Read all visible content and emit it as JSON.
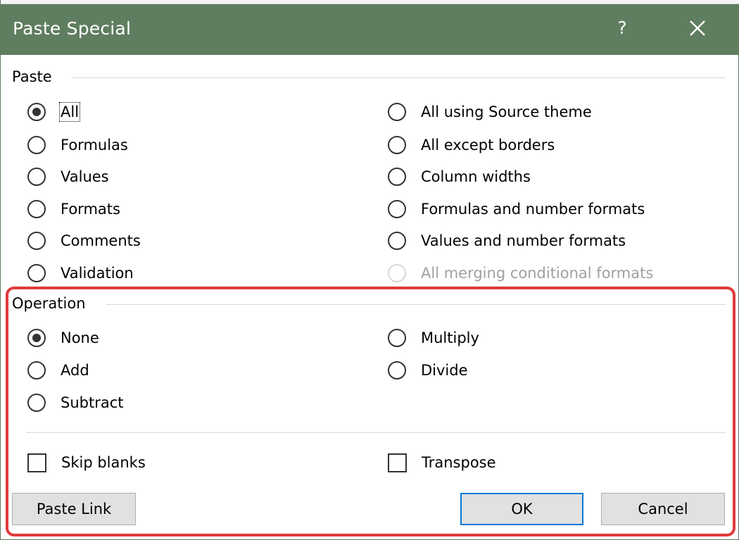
{
  "window": {
    "title": "Paste Special",
    "help_label": "?"
  },
  "paste_group": {
    "label": "Paste",
    "left_options": [
      {
        "label": "All",
        "checked": true
      },
      {
        "label": "Formulas",
        "checked": false
      },
      {
        "label": "Values",
        "checked": false
      },
      {
        "label": "Formats",
        "checked": false
      },
      {
        "label": "Comments",
        "checked": false
      },
      {
        "label": "Validation",
        "checked": false
      }
    ],
    "right_options": [
      {
        "label": "All using Source theme",
        "checked": false
      },
      {
        "label": "All except borders",
        "checked": false
      },
      {
        "label": "Column widths",
        "checked": false
      },
      {
        "label": "Formulas and number formats",
        "checked": false
      },
      {
        "label": "Values and number formats",
        "checked": false
      },
      {
        "label": "All merging conditional formats",
        "checked": false,
        "disabled": true
      }
    ]
  },
  "operation_group": {
    "label": "Operation",
    "left_options": [
      {
        "label": "None",
        "checked": true
      },
      {
        "label": "Add",
        "checked": false
      },
      {
        "label": "Subtract",
        "checked": false
      }
    ],
    "right_options": [
      {
        "label": "Multiply",
        "checked": false
      },
      {
        "label": "Divide",
        "checked": false
      }
    ]
  },
  "checkboxes": {
    "skip_blanks": {
      "label": "Skip blanks",
      "checked": false
    },
    "transpose": {
      "label": "Transpose",
      "checked": false
    }
  },
  "buttons": {
    "paste_link": "Paste Link",
    "ok": "OK",
    "cancel": "Cancel"
  },
  "colors": {
    "titlebar": "#5f7d5f",
    "highlight": "#e03a3a",
    "default_button_border": "#0078d7"
  }
}
